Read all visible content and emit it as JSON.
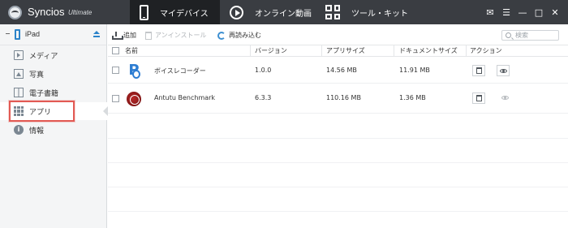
{
  "titlebar": {
    "app_name": "Syncios",
    "edition": "Ultimate",
    "nav": [
      {
        "label": "マイデバイス",
        "active": true,
        "icon": "phone-icon"
      },
      {
        "label": "オンライン動画",
        "active": false,
        "icon": "play-icon"
      },
      {
        "label": "ツール・キット",
        "active": false,
        "icon": "grid-icon"
      }
    ],
    "window_controls": [
      {
        "label": "✉",
        "icon": "message-icon"
      },
      {
        "label": "☰",
        "icon": "menu-icon"
      },
      {
        "label": "—",
        "icon": "minimize-icon"
      },
      {
        "label": "□",
        "icon": "maximize-icon"
      },
      {
        "label": "✕",
        "icon": "close-icon"
      }
    ]
  },
  "sidebar": {
    "device": "iPad",
    "items": [
      {
        "label": "メディア",
        "icon": "media-icon"
      },
      {
        "label": "写真",
        "icon": "photo-icon"
      },
      {
        "label": "電子書籍",
        "icon": "book-icon"
      },
      {
        "label": "アプリ",
        "icon": "apps-icon",
        "active": true
      },
      {
        "label": "情報",
        "icon": "info-icon"
      }
    ]
  },
  "toolbar": {
    "add_label": "追加",
    "uninstall_label": "アンインストール",
    "reload_label": "再読み込む",
    "search_placeholder": "検索"
  },
  "table": {
    "headers": [
      "名前",
      "バージョン",
      "アプリサイズ",
      "ドキュメントサイズ",
      "アクション"
    ],
    "rows": [
      {
        "name": "ボイスレコーダー",
        "version": "1.0.0",
        "app_size": "14.56 MB",
        "doc_size": "11.91 MB",
        "icon": "voice-recorder-icon"
      },
      {
        "name": "Antutu Benchmark",
        "version": "6.3.3",
        "app_size": "110.16 MB",
        "doc_size": "1.36 MB",
        "icon": "antutu-icon"
      }
    ]
  },
  "colors": {
    "titlebar": "#3a3d42",
    "active_tab": "#1f2124",
    "accent_blue": "#2b83c9",
    "highlight_red": "#e25a54",
    "sidebar_bg": "#f4f5f6"
  }
}
